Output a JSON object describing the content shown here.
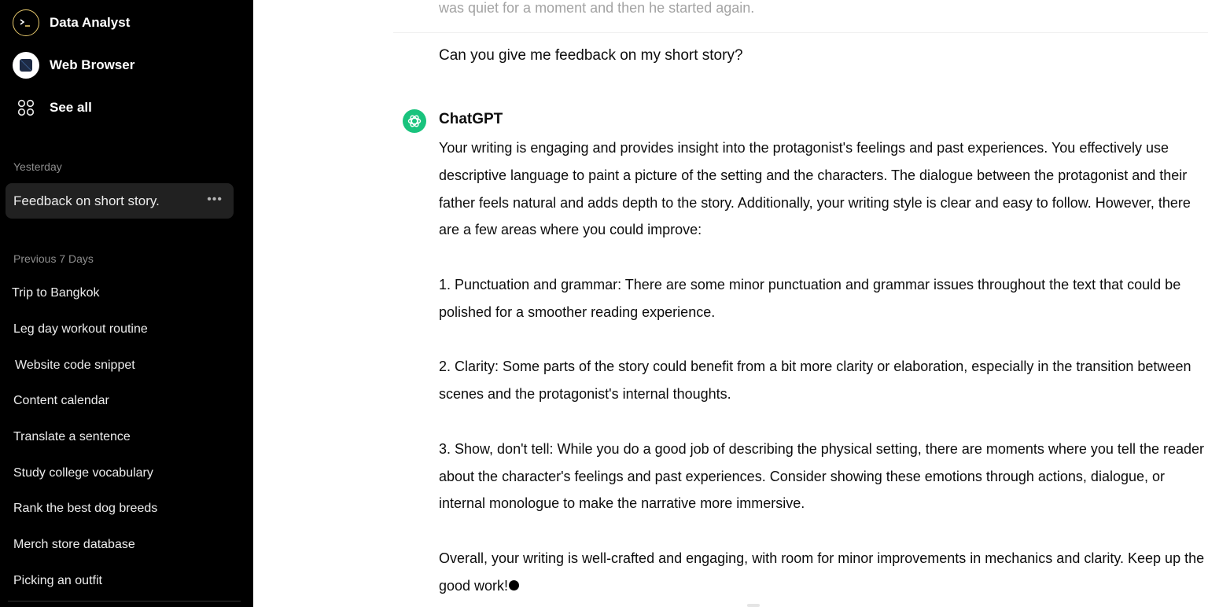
{
  "sidebar": {
    "gpts": [
      {
        "label": "Data Analyst",
        "icon": "terminal-icon"
      },
      {
        "label": "Web Browser",
        "icon": "browser-icon"
      },
      {
        "label": "See all",
        "icon": "grid-icon"
      }
    ],
    "sections": [
      {
        "label": "Yesterday",
        "items": [
          {
            "label": "Feedback on short story.",
            "active": true
          }
        ]
      },
      {
        "label": "Previous 7 Days",
        "items": [
          {
            "label": "Trip to Bangkok"
          },
          {
            "label": "Leg day workout routine"
          },
          {
            "label": "Website code snippet"
          },
          {
            "label": "Content calendar"
          },
          {
            "label": "Translate a sentence"
          },
          {
            "label": "Study college vocabulary"
          },
          {
            "label": "Rank the best dog breeds"
          },
          {
            "label": "Merch store database"
          },
          {
            "label": "Picking an outfit"
          }
        ]
      }
    ],
    "more_options_glyph": "•••"
  },
  "conversation": {
    "previous_text_fragment": "was quiet for a moment and then he started again.",
    "user_message": "Can you give me feedback on my short story?",
    "assistant_name": "ChatGPT",
    "assistant_paragraphs": [
      "Your writing is engaging and provides insight into the protagonist's feelings and past experiences. You effectively use descriptive language to paint a picture of the setting and the characters. The dialogue between the protagonist and their father feels natural and adds depth to the story. Additionally, your writing style is clear and easy to follow. However, there are a few areas where you could improve:",
      "1. Punctuation and grammar: There are some minor punctuation and grammar issues throughout the text that could be polished for a smoother reading experience.",
      "2. Clarity: Some parts of the story could benefit from a bit more clarity or elaboration, especially in the transition between scenes and the protagonist's internal thoughts.",
      "3. Show, don't tell: While you do a good job of describing the physical setting, there are moments where you tell the reader about the character's feelings and past experiences. Consider showing these emotions through actions, dialogue, or internal monologue to make the narrative more immersive.",
      "Overall, your writing is well-crafted and engaging, with room for minor improvements in mechanics and clarity. Keep up the good work!"
    ]
  },
  "colors": {
    "sidebar_bg": "#000000",
    "active_item_bg": "#212121",
    "accent": "#19c37d"
  }
}
